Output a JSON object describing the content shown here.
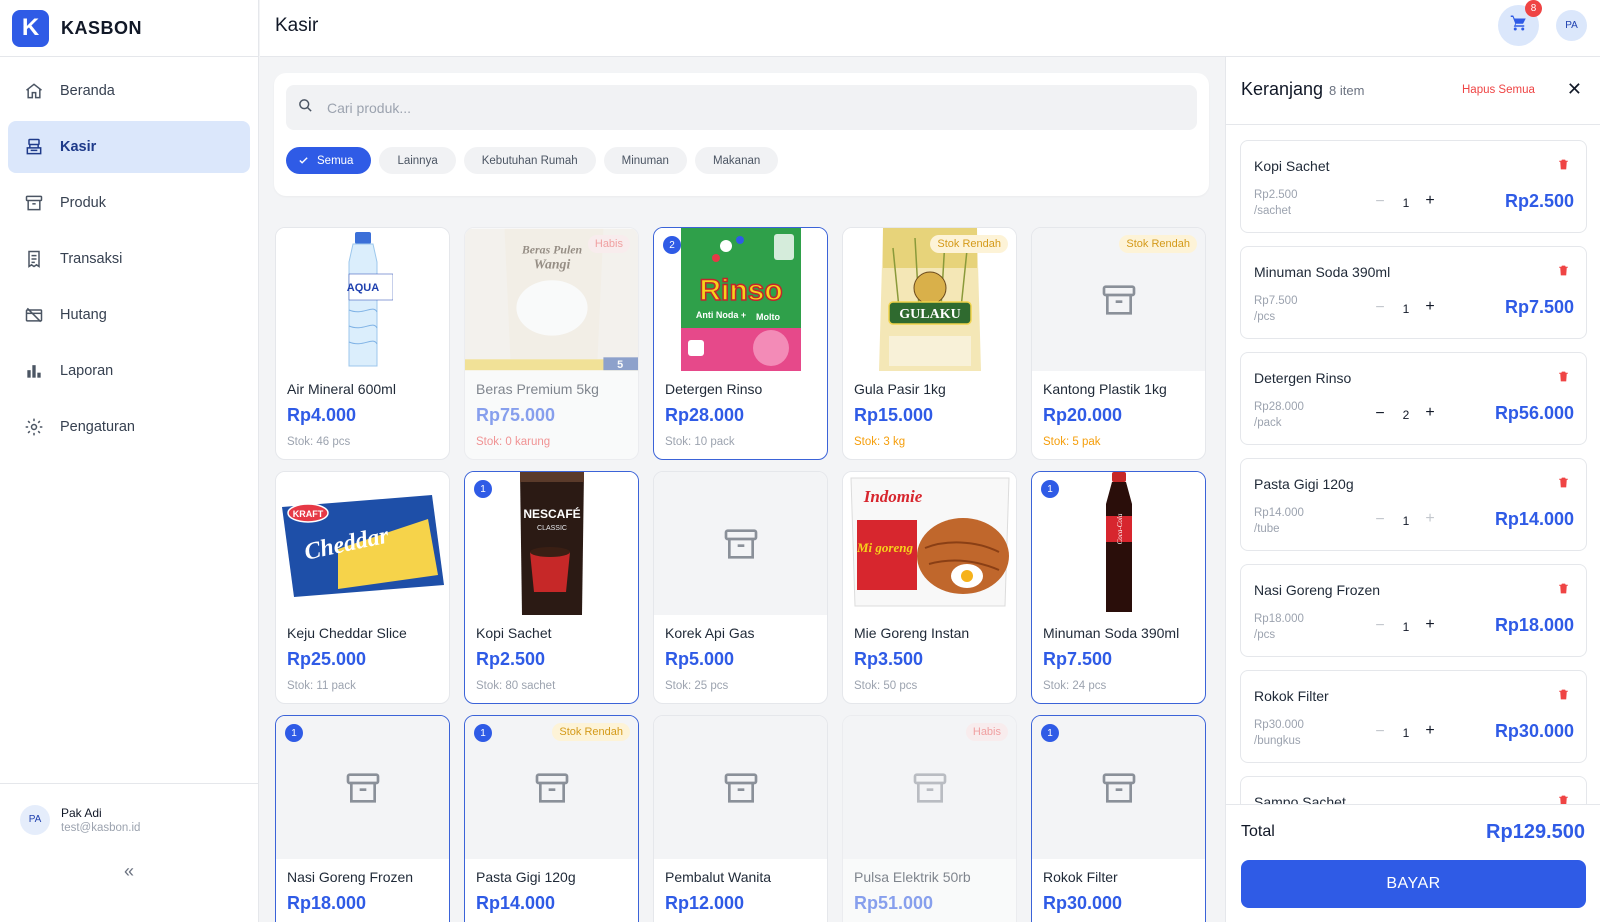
{
  "brand": {
    "logo_letter": "K",
    "name": "KASBON"
  },
  "sidebar": {
    "items": [
      {
        "label": "Beranda",
        "icon": "home-icon"
      },
      {
        "label": "Kasir",
        "icon": "register-icon",
        "active": true
      },
      {
        "label": "Produk",
        "icon": "box-icon"
      },
      {
        "label": "Transaksi",
        "icon": "receipt-icon"
      },
      {
        "label": "Hutang",
        "icon": "debt-icon"
      },
      {
        "label": "Laporan",
        "icon": "bar-chart-icon"
      },
      {
        "label": "Pengaturan",
        "icon": "gear-icon"
      }
    ],
    "user": {
      "initials": "PA",
      "name": "Pak Adi",
      "email": "test@kasbon.id"
    },
    "collapse_label": "«"
  },
  "header": {
    "title": "Kasir",
    "cart_badge": "8",
    "avatar_initials": "PA"
  },
  "search": {
    "placeholder": "Cari produk...",
    "value": ""
  },
  "categories": [
    {
      "label": "Semua",
      "active": true
    },
    {
      "label": "Lainnya"
    },
    {
      "label": "Kebutuhan Rumah"
    },
    {
      "label": "Minuman"
    },
    {
      "label": "Makanan"
    }
  ],
  "products": [
    {
      "name": "Air Mineral 600ml",
      "price": "Rp4.000",
      "stock": "Stok: 46 pcs",
      "image": "water-bottle"
    },
    {
      "name": "Beras Premium 5kg",
      "price": "Rp75.000",
      "stock": "Stok: 0 karung",
      "image": "rice-bag",
      "status": "Habis"
    },
    {
      "name": "Detergen Rinso",
      "price": "Rp28.000",
      "stock": "Stok: 10 pack",
      "image": "detergent",
      "qty": "2"
    },
    {
      "name": "Gula Pasir 1kg",
      "price": "Rp15.000",
      "stock": "Stok: 3 kg",
      "image": "sugar-bag",
      "status": "Stok Rendah"
    },
    {
      "name": "Kantong Plastik 1kg",
      "price": "Rp20.000",
      "stock": "Stok: 5 pak",
      "image": "placeholder",
      "status": "Stok Rendah"
    },
    {
      "name": "Keju Cheddar Slice",
      "price": "Rp25.000",
      "stock": "Stok: 11 pack",
      "image": "cheese"
    },
    {
      "name": "Kopi Sachet",
      "price": "Rp2.500",
      "stock": "Stok: 80 sachet",
      "image": "coffee",
      "qty": "1"
    },
    {
      "name": "Korek Api Gas",
      "price": "Rp5.000",
      "stock": "Stok: 25 pcs",
      "image": "placeholder"
    },
    {
      "name": "Mie Goreng Instan",
      "price": "Rp3.500",
      "stock": "Stok: 50 pcs",
      "image": "noodle"
    },
    {
      "name": "Minuman Soda 390ml",
      "price": "Rp7.500",
      "stock": "Stok: 24 pcs",
      "image": "soda",
      "qty": "1"
    },
    {
      "name": "Nasi Goreng Frozen",
      "price": "Rp18.000",
      "stock": "",
      "image": "placeholder",
      "qty": "1"
    },
    {
      "name": "Pasta Gigi 120g",
      "price": "Rp14.000",
      "stock": "",
      "image": "placeholder",
      "qty": "1",
      "status": "Stok Rendah"
    },
    {
      "name": "Pembalut Wanita",
      "price": "Rp12.000",
      "stock": "",
      "image": "placeholder"
    },
    {
      "name": "Pulsa Elektrik 50rb",
      "price": "Rp51.000",
      "stock": "",
      "image": "placeholder",
      "status": "Habis"
    },
    {
      "name": "Rokok Filter",
      "price": "Rp30.000",
      "stock": "",
      "image": "placeholder",
      "qty": "1"
    }
  ],
  "image_text": {
    "water": "AQUA",
    "rice_line1": "Beras Pulen",
    "rice_line2": "Wangi",
    "rice_size": "5",
    "detergent": "Rinso",
    "detergent_sub": "Anti Noda +",
    "detergent_molto": "Molto",
    "sugar": "GULAKU",
    "cheese_brand": "KRAFT",
    "cheese": "Cheddar",
    "coffee": "NESCAFÉ",
    "coffee_sub": "CLASSIC",
    "noodle": "Indomie",
    "noodle_sub": "Mi goreng",
    "soda": "Coca-Cola"
  },
  "cart": {
    "title": "Keranjang",
    "count": "8 item",
    "clear_all": "Hapus Semua",
    "close": "✕",
    "items": [
      {
        "name": "Kopi Sachet",
        "unit_price": "Rp2.500",
        "unit": "/sachet",
        "qty": "1",
        "total": "Rp2.500"
      },
      {
        "name": "Minuman Soda 390ml",
        "unit_price": "Rp7.500",
        "unit": "/pcs",
        "qty": "1",
        "total": "Rp7.500"
      },
      {
        "name": "Detergen Rinso",
        "unit_price": "Rp28.000",
        "unit": "/pack",
        "qty": "2",
        "total": "Rp56.000"
      },
      {
        "name": "Pasta Gigi 120g",
        "unit_price": "Rp14.000",
        "unit": "/tube",
        "qty": "1",
        "total": "Rp14.000"
      },
      {
        "name": "Nasi Goreng Frozen",
        "unit_price": "Rp18.000",
        "unit": "/pcs",
        "qty": "1",
        "total": "Rp18.000"
      },
      {
        "name": "Rokok Filter",
        "unit_price": "Rp30.000",
        "unit": "/bungkus",
        "qty": "1",
        "total": "Rp30.000"
      },
      {
        "name": "Sampo Sachet",
        "unit_price": "",
        "unit": "",
        "qty": "",
        "total": ""
      }
    ],
    "total_label": "Total",
    "total_value": "Rp129.500",
    "pay_label": "BAYAR"
  },
  "colors": {
    "accent": "#2f5be6",
    "active_bg": "#dbe7fb",
    "danger": "#ef4444",
    "warning": "#f59e0b"
  }
}
